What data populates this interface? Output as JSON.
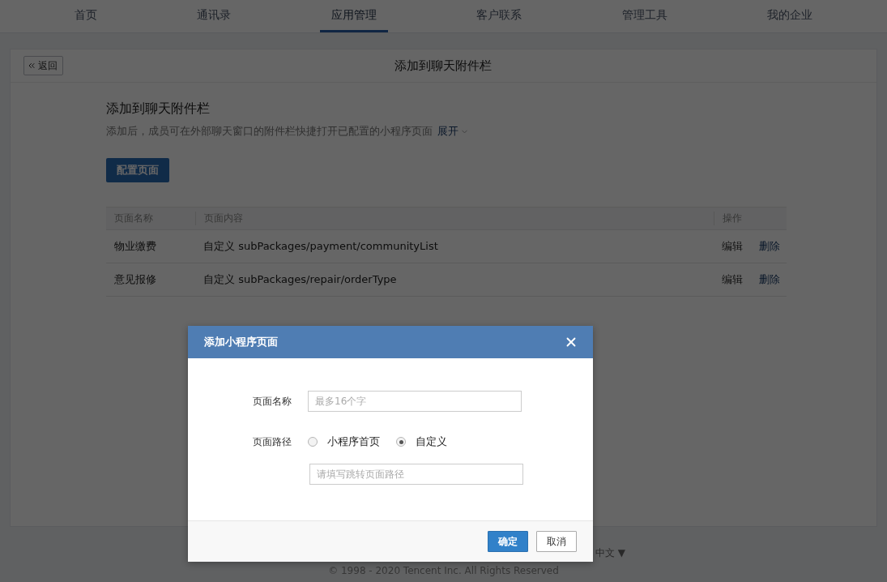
{
  "nav": {
    "items": [
      {
        "label": "首页",
        "selected": false
      },
      {
        "label": "通讯录",
        "selected": false
      },
      {
        "label": "应用管理",
        "selected": true
      },
      {
        "label": "客户联系",
        "selected": false
      },
      {
        "label": "管理工具",
        "selected": false
      },
      {
        "label": "我的企业",
        "selected": false
      }
    ]
  },
  "card": {
    "back_button": "返回",
    "title": "添加到聊天附件栏"
  },
  "section": {
    "heading": "添加到聊天附件栏",
    "description": "添加后，成员可在外部聊天窗口的附件栏快捷打开已配置的小程序页面",
    "expand_link": "展开",
    "primary_button": "配置页面"
  },
  "table": {
    "columns": [
      "页面名称",
      "页面内容",
      "操作"
    ],
    "rows": [
      {
        "name": "物业缴费",
        "content": "自定义 subPackages/payment/communityList",
        "actions": [
          "编辑",
          "删除"
        ]
      },
      {
        "name": "意见报修",
        "content": "自定义 subPackages/repair/orderType",
        "actions": [
          "编辑",
          "删除"
        ]
      }
    ]
  },
  "footer": {
    "language": "中文 ▼",
    "copyright": "© 1998 - 2020 Tencent Inc. All Rights Reserved"
  },
  "dialog": {
    "title": "添加小程序页面",
    "name_label": "页面名称",
    "name_placeholder": "最多16个字",
    "path_label": "页面路径",
    "path_options": [
      {
        "label": "小程序首页",
        "selected": false
      },
      {
        "label": "自定义",
        "selected": true
      }
    ],
    "path_placeholder": "请填写跳转页面路径",
    "buttons": [
      {
        "label": "确定",
        "kind": "primary"
      },
      {
        "label": "取消",
        "kind": "default"
      }
    ]
  }
}
